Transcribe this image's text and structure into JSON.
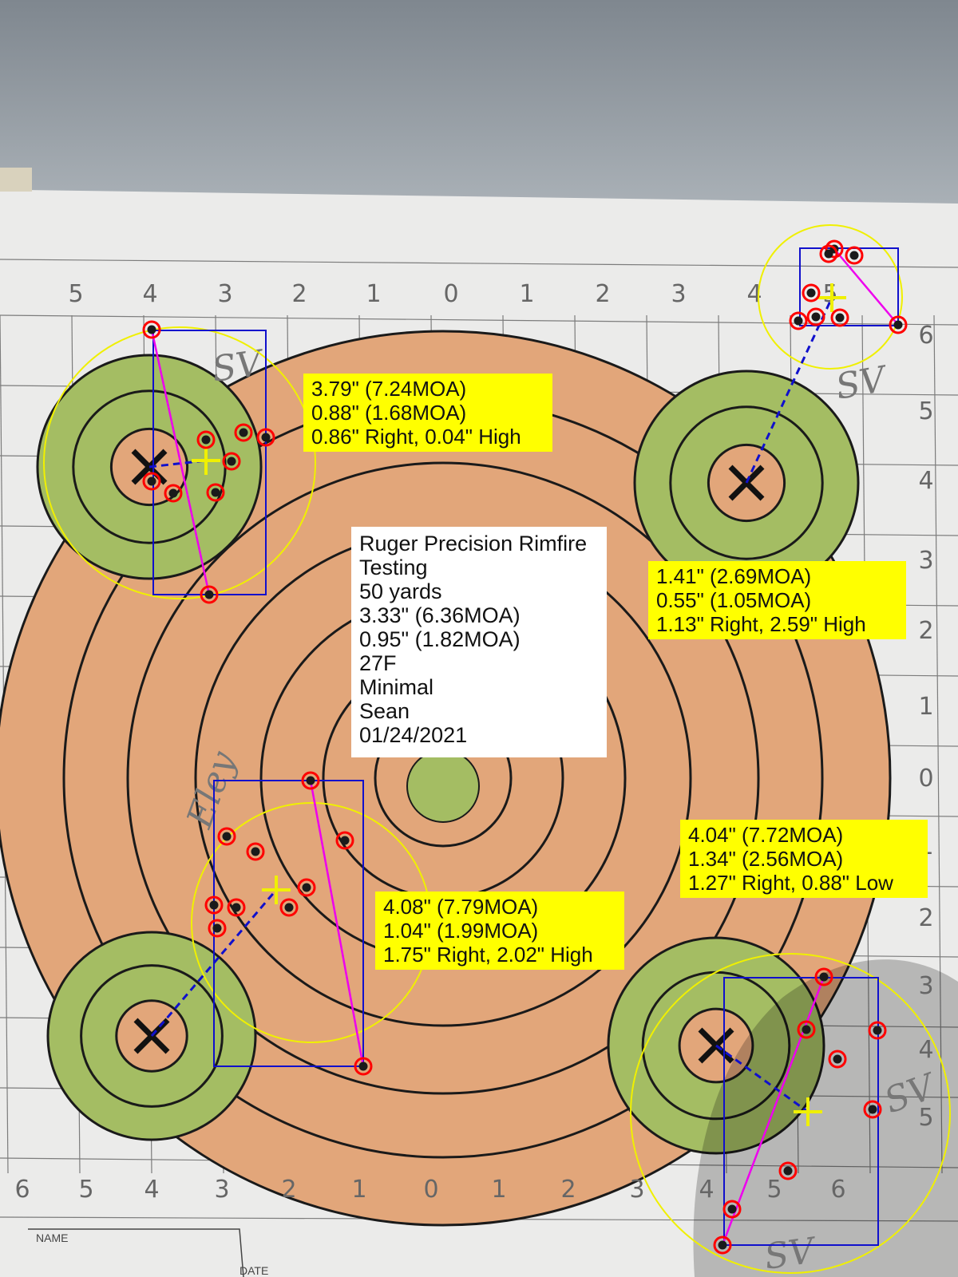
{
  "info": {
    "lines": [
      "Ruger Precision Rimfire",
      "Testing",
      "50 yards",
      "3.33\" (6.36MOA)",
      "0.95\" (1.82MOA)",
      "27F",
      "Minimal",
      "Sean",
      "01/24/2021"
    ]
  },
  "groups": [
    {
      "id": "top-left",
      "lines": [
        "3.79\" (7.24MOA)",
        "0.88\" (1.68MOA)",
        "0.86\" Right,  0.04\" High"
      ]
    },
    {
      "id": "top-right",
      "lines": [
        "1.41\" (2.69MOA)",
        "0.55\" (1.05MOA)",
        "1.13\" Right,  2.59\" High"
      ]
    },
    {
      "id": "bottom-left",
      "lines": [
        "4.08\" (7.79MOA)",
        "1.04\" (1.99MOA)",
        "1.75\" Right,  2.02\" High"
      ]
    },
    {
      "id": "bottom-right",
      "lines": [
        "4.04\" (7.72MOA)",
        "1.34\" (2.56MOA)",
        "1.27\" Right,  0.88\" Low"
      ]
    }
  ],
  "grid_labels": {
    "top": [
      "5",
      "4",
      "3",
      "2",
      "1",
      "0",
      "1",
      "2",
      "3",
      "4",
      "5"
    ],
    "bottom": [
      "6",
      "5",
      "4",
      "3",
      "2",
      "1",
      "0",
      "1",
      "2",
      "3",
      "4",
      "5",
      "6"
    ],
    "right": [
      "6",
      "5",
      "4",
      "3",
      "2",
      "1",
      "0",
      "1",
      "2",
      "3",
      "4",
      "5"
    ]
  },
  "handwriting": [
    "SV",
    "SV",
    "Eley",
    "SV",
    "SV"
  ],
  "form_fields": [
    "NAME",
    "DATE"
  ],
  "colors": {
    "sky": "#8e969e",
    "target_orange": "#e2a67a",
    "target_green": "#a4bd63",
    "label_yellow": "#ffff00",
    "shot_ring": "#ff0000",
    "box_blue": "#1010cc",
    "spread_magenta": "#ee00ee",
    "circle_yellow": "#f0f000"
  }
}
